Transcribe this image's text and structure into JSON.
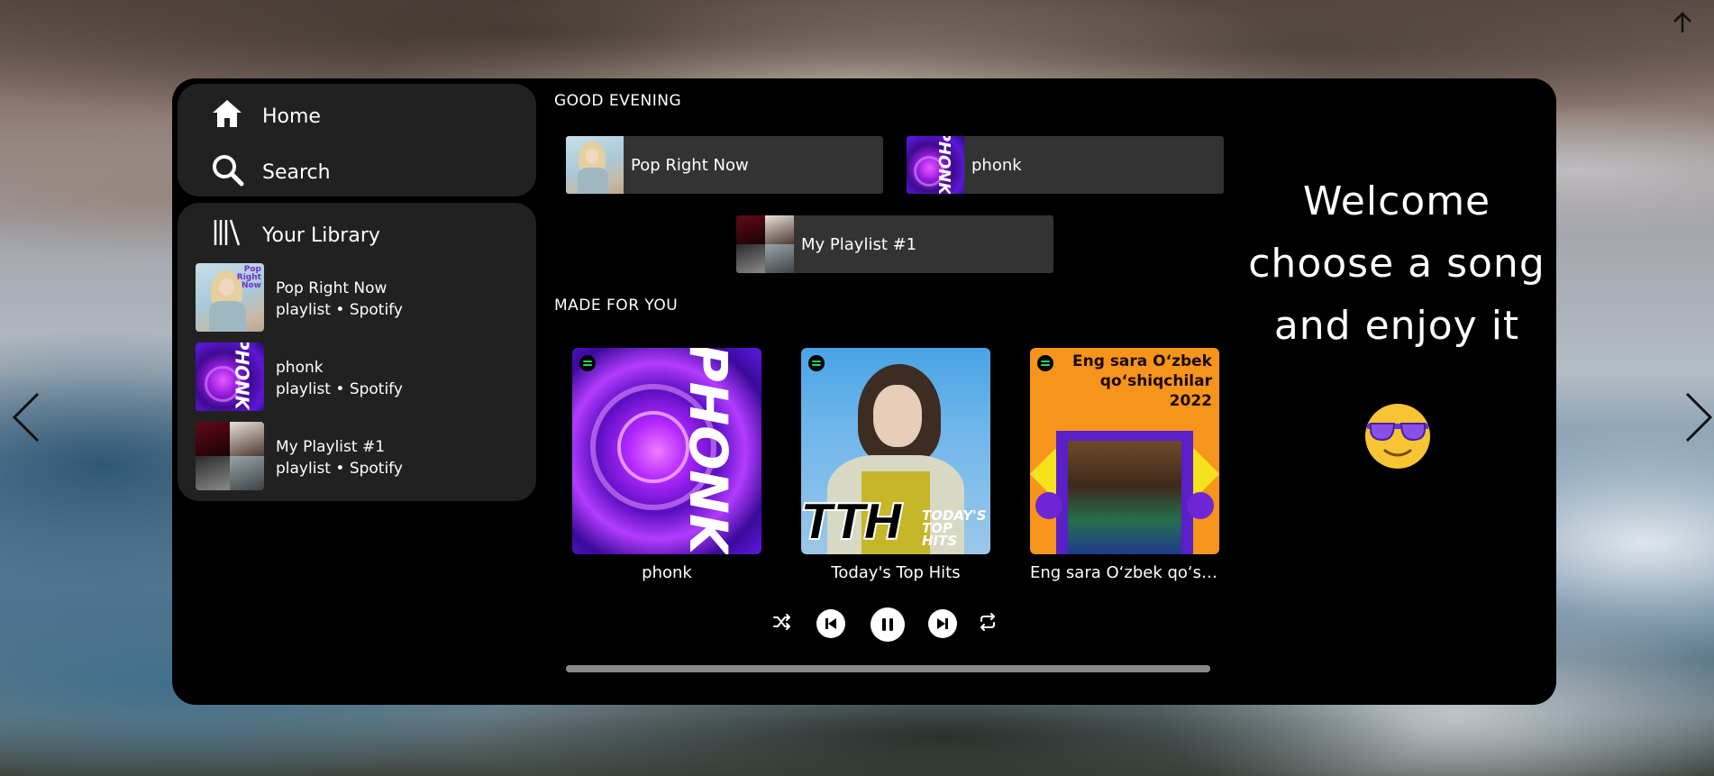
{
  "nav": {
    "home_label": "Home",
    "search_label": "Search",
    "library_label": "Your Library"
  },
  "library": {
    "items": [
      {
        "title": "Pop Right Now",
        "subtitle_type": "playlist",
        "subtitle_owner": "Spotify",
        "thumb_icon": "pop-right-now-cover"
      },
      {
        "title": "phonk",
        "subtitle_type": "playlist",
        "subtitle_owner": "Spotify",
        "thumb_icon": "phonk-cover"
      },
      {
        "title": "My Playlist #1",
        "subtitle_type": "playlist",
        "subtitle_owner": "Spotify",
        "thumb_icon": "my-playlist-cover"
      }
    ]
  },
  "greeting": {
    "title": "GOOD EVENING",
    "shortcuts": [
      "Pop Right Now",
      "phonk",
      "My Playlist #1"
    ]
  },
  "made_for_you": {
    "title": "MADE FOR YOU",
    "cards": [
      "phonk",
      "Today's Top Hits",
      "Eng sara O‘zbek qo‘shiqchilar 2022"
    ],
    "cover_texts": {
      "pop_label": "Pop Right Now",
      "phonk_word": "PHONK",
      "hits_word": "TTH",
      "hits_sub": "TODAY'S TOP HITS",
      "uz_title": "Eng sara O‘zbek qo‘shiqchilar 2022"
    }
  },
  "player": {
    "controls": [
      "shuffle-icon",
      "previous-icon",
      "pause-icon",
      "next-icon",
      "repeat-icon"
    ],
    "progress": 1.0
  },
  "welcome": {
    "line1": "Welcome",
    "line2": "choose a song",
    "line3": "and enjoy it",
    "emoji": "smiling-face-with-sunglasses"
  },
  "colors": {
    "app_bg": "#000000",
    "panel_bg": "#212121",
    "shortcut_bg": "#333333",
    "text": "#ffffff",
    "spotify_green": "#1ed760"
  }
}
